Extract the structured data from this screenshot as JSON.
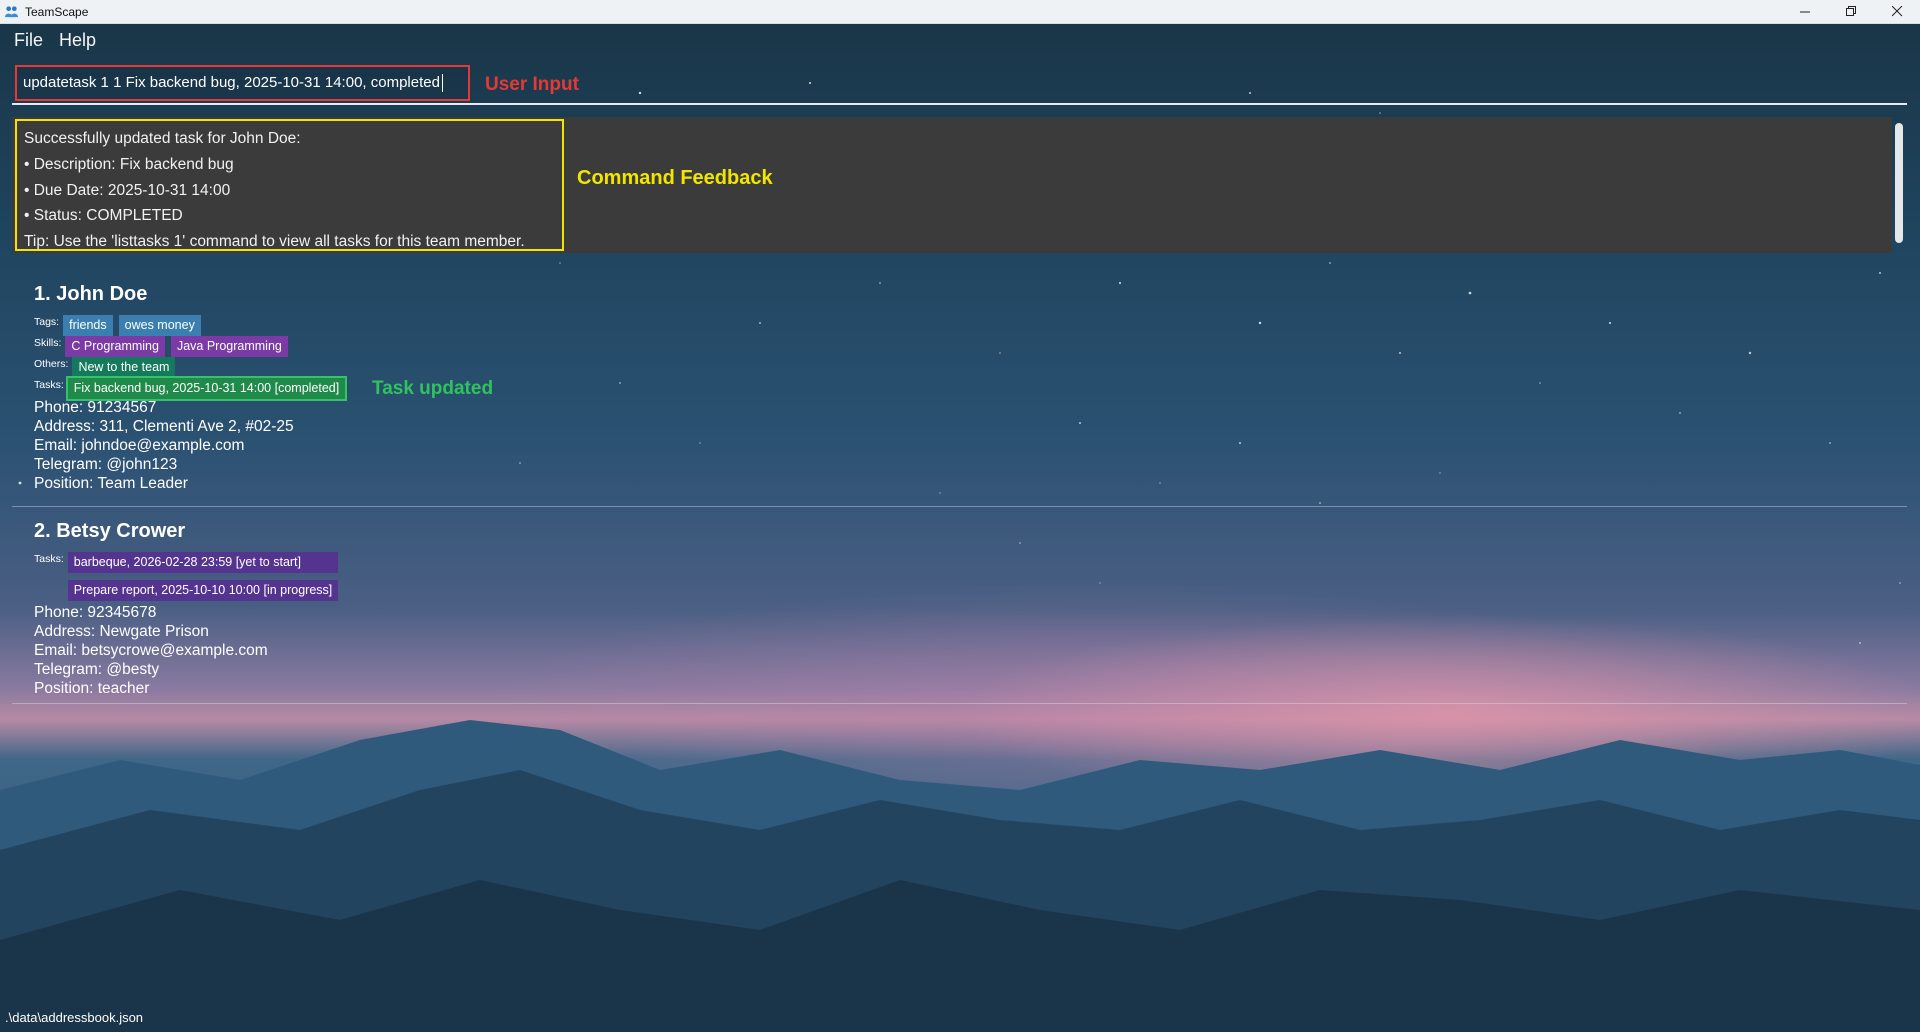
{
  "window": {
    "title": "TeamScape"
  },
  "menu": {
    "items": [
      "File",
      "Help"
    ]
  },
  "command": {
    "value": "updatetask 1 1 Fix backend bug, 2025-10-31 14:00, completed",
    "annotation": "User Input"
  },
  "result": {
    "lines": [
      "Successfully updated task for John Doe:",
      "• Description: Fix backend bug",
      "• Due Date: 2025-10-31 14:00",
      "• Status: COMPLETED",
      "Tip: Use the 'listtasks 1' command to view all tasks for this team member."
    ],
    "annotation": "Command Feedback"
  },
  "persons": [
    {
      "name": "1. John Doe",
      "tags_label": "Tags:",
      "tags": [
        "friends",
        "owes money"
      ],
      "skills_label": "Skills:",
      "skills": [
        "C Programming",
        "Java Programming"
      ],
      "others_label": "Others:",
      "others": [
        "New to the team"
      ],
      "tasks_label": "Tasks:",
      "tasks": [
        "Fix backend bug, 2025-10-31 14:00 [completed]"
      ],
      "task_annotation": "Task updated",
      "phone": "Phone: 91234567",
      "address": "Address: 311, Clementi Ave 2, #02-25",
      "email": "Email: johndoe@example.com",
      "telegram": "Telegram: @john123",
      "position": "Position: Team Leader"
    },
    {
      "name": "2. Betsy Crower",
      "tasks_label": "Tasks:",
      "tasks": [
        "barbeque, 2026-02-28 23:59 [yet to start]",
        "Prepare report, 2025-10-10 10:00 [in progress]"
      ],
      "phone": "Phone: 92345678",
      "address": "Address: Newgate Prison",
      "email": "Email: betsycrowe@example.com",
      "telegram": "Telegram: @besty",
      "position": "Position: teacher"
    }
  ],
  "status_bar": {
    "path": ".\\data\\addressbook.json"
  },
  "colors": {
    "user_input_highlight": "#e53935",
    "feedback_highlight": "#f2e600",
    "task_updated_highlight": "#2ec35d"
  }
}
